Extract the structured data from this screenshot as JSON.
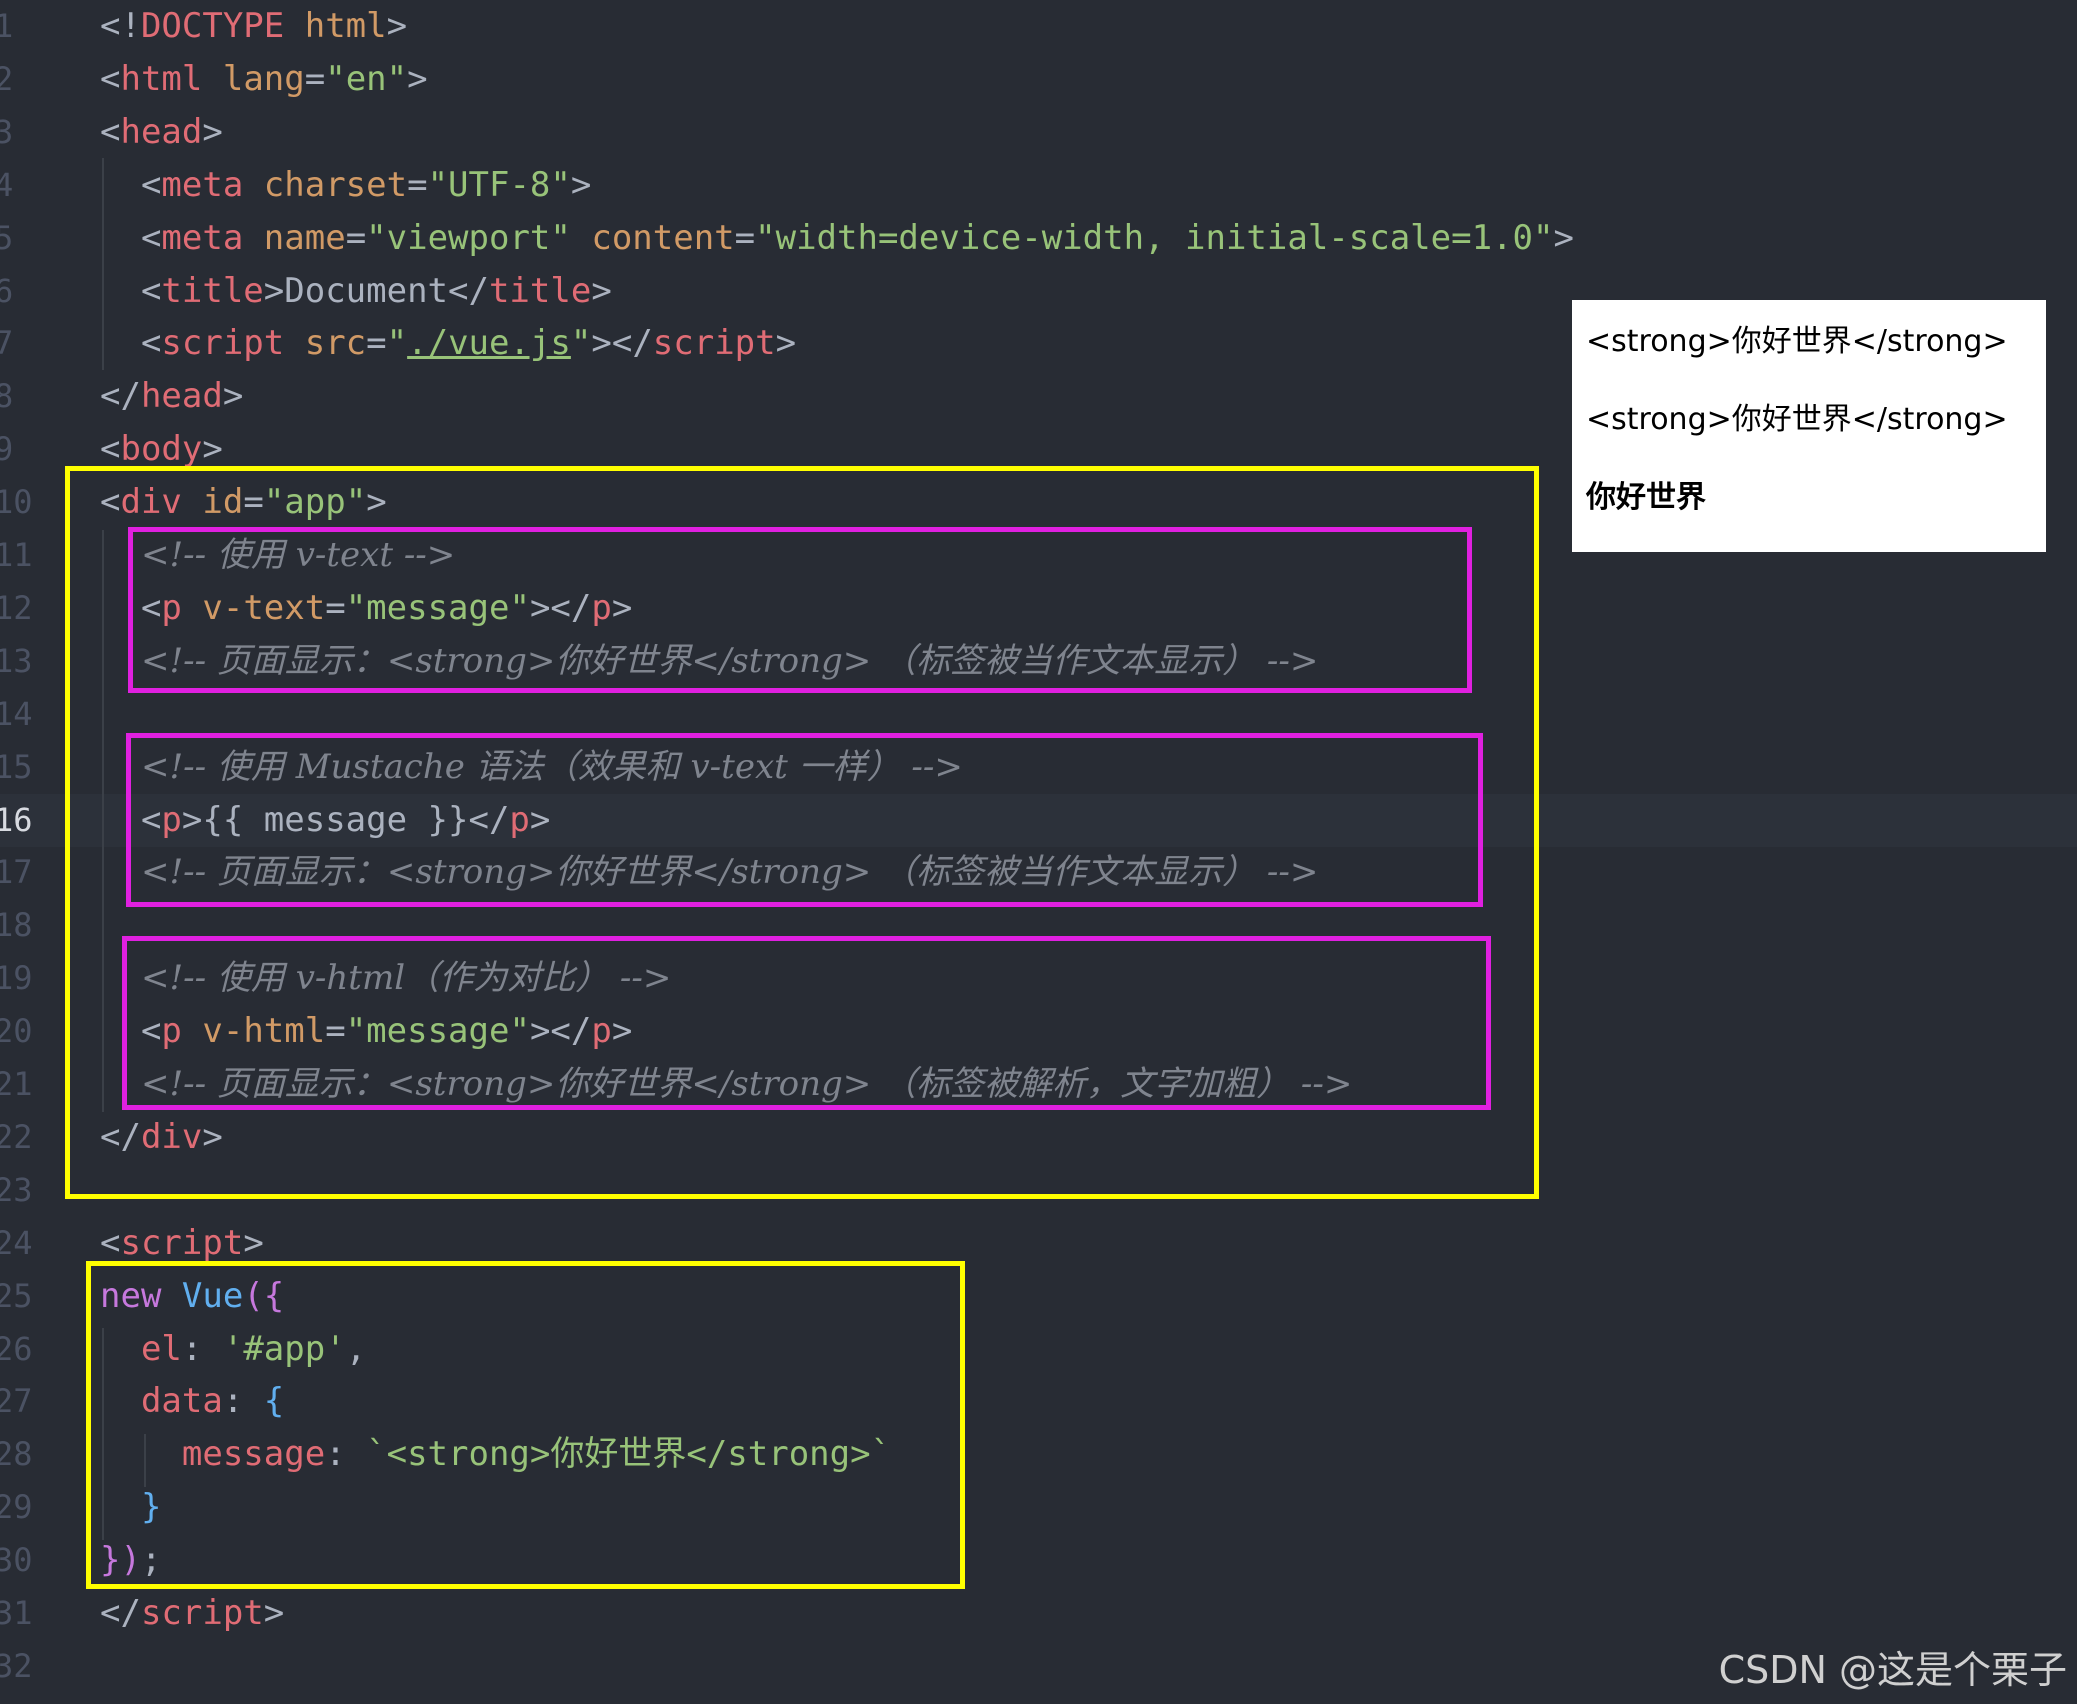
{
  "editor": {
    "current_line": 16,
    "lines": [
      {
        "n": "1",
        "tokens": [
          [
            "punc",
            "<!"
          ],
          [
            "tag",
            "DOCTYPE"
          ],
          [
            "punc",
            " "
          ],
          [
            "attr",
            "html"
          ],
          [
            "punc",
            ">"
          ]
        ]
      },
      {
        "n": "2",
        "tokens": [
          [
            "punc",
            "<"
          ],
          [
            "tag",
            "html"
          ],
          [
            "punc",
            " "
          ],
          [
            "attr",
            "lang"
          ],
          [
            "punc",
            "="
          ],
          [
            "str",
            "\"en\""
          ],
          [
            "punc",
            ">"
          ]
        ]
      },
      {
        "n": "3",
        "tokens": [
          [
            "punc",
            "<"
          ],
          [
            "tag",
            "head"
          ],
          [
            "punc",
            ">"
          ]
        ]
      },
      {
        "n": "4",
        "tokens": [
          [
            "punc",
            "  <"
          ],
          [
            "tag",
            "meta"
          ],
          [
            "punc",
            " "
          ],
          [
            "attr",
            "charset"
          ],
          [
            "punc",
            "="
          ],
          [
            "str",
            "\"UTF-8\""
          ],
          [
            "punc",
            ">"
          ]
        ]
      },
      {
        "n": "5",
        "tokens": [
          [
            "punc",
            "  <"
          ],
          [
            "tag",
            "meta"
          ],
          [
            "punc",
            " "
          ],
          [
            "attr",
            "name"
          ],
          [
            "punc",
            "="
          ],
          [
            "str",
            "\"viewport\""
          ],
          [
            "punc",
            " "
          ],
          [
            "attr",
            "content"
          ],
          [
            "punc",
            "="
          ],
          [
            "str",
            "\"width=device-width, initial-scale=1.0\""
          ],
          [
            "punc",
            ">"
          ]
        ]
      },
      {
        "n": "6",
        "tokens": [
          [
            "punc",
            "  <"
          ],
          [
            "tag",
            "title"
          ],
          [
            "punc",
            ">Document</"
          ],
          [
            "tag",
            "title"
          ],
          [
            "punc",
            ">"
          ]
        ]
      },
      {
        "n": "7",
        "tokens": [
          [
            "punc",
            "  <"
          ],
          [
            "tag",
            "script"
          ],
          [
            "punc",
            " "
          ],
          [
            "attr",
            "src"
          ],
          [
            "punc",
            "="
          ],
          [
            "str",
            "\""
          ],
          [
            "link",
            "./vue.js"
          ],
          [
            "str",
            "\""
          ],
          [
            "punc",
            "></"
          ],
          [
            "tag",
            "script"
          ],
          [
            "punc",
            ">"
          ]
        ]
      },
      {
        "n": "8",
        "tokens": [
          [
            "punc",
            "</"
          ],
          [
            "tag",
            "head"
          ],
          [
            "punc",
            ">"
          ]
        ]
      },
      {
        "n": "9",
        "tokens": [
          [
            "punc",
            "<"
          ],
          [
            "tag",
            "body"
          ],
          [
            "punc",
            ">"
          ]
        ]
      },
      {
        "n": "10",
        "tokens": [
          [
            "punc",
            "<"
          ],
          [
            "tag",
            "div"
          ],
          [
            "punc",
            " "
          ],
          [
            "attr",
            "id"
          ],
          [
            "punc",
            "="
          ],
          [
            "str",
            "\"app\""
          ],
          [
            "punc",
            ">"
          ]
        ]
      },
      {
        "n": "11",
        "tokens": [
          [
            "punc",
            "  "
          ],
          [
            "cm",
            "<!-- 使用 v-text -->"
          ]
        ]
      },
      {
        "n": "12",
        "tokens": [
          [
            "punc",
            "  <"
          ],
          [
            "tag",
            "p"
          ],
          [
            "punc",
            " "
          ],
          [
            "attr",
            "v-text"
          ],
          [
            "punc",
            "="
          ],
          [
            "str",
            "\"message\""
          ],
          [
            "punc",
            "></"
          ],
          [
            "tag",
            "p"
          ],
          [
            "punc",
            ">"
          ]
        ]
      },
      {
        "n": "13",
        "tokens": [
          [
            "punc",
            "  "
          ],
          [
            "cm",
            "<!-- 页面显示：<strong>你好世界</strong> （标签被当作文本显示） -->"
          ]
        ]
      },
      {
        "n": "14",
        "tokens": []
      },
      {
        "n": "15",
        "tokens": [
          [
            "punc",
            "  "
          ],
          [
            "cm",
            "<!-- 使用 Mustache 语法（效果和 v-text 一样） -->"
          ]
        ]
      },
      {
        "n": "16",
        "tokens": [
          [
            "punc",
            "  <"
          ],
          [
            "tag",
            "p"
          ],
          [
            "punc",
            ">{{ message }}</"
          ],
          [
            "tag",
            "p"
          ],
          [
            "punc",
            ">"
          ]
        ]
      },
      {
        "n": "17",
        "tokens": [
          [
            "punc",
            "  "
          ],
          [
            "cm",
            "<!-- 页面显示：<strong>你好世界</strong> （标签被当作文本显示） -->"
          ]
        ]
      },
      {
        "n": "18",
        "tokens": []
      },
      {
        "n": "19",
        "tokens": [
          [
            "punc",
            "  "
          ],
          [
            "cm",
            "<!-- 使用 v-html（作为对比） -->"
          ]
        ]
      },
      {
        "n": "20",
        "tokens": [
          [
            "punc",
            "  <"
          ],
          [
            "tag",
            "p"
          ],
          [
            "punc",
            " "
          ],
          [
            "attr",
            "v-html"
          ],
          [
            "punc",
            "="
          ],
          [
            "str",
            "\"message\""
          ],
          [
            "punc",
            "></"
          ],
          [
            "tag",
            "p"
          ],
          [
            "punc",
            ">"
          ]
        ]
      },
      {
        "n": "21",
        "tokens": [
          [
            "punc",
            "  "
          ],
          [
            "cm",
            "<!-- 页面显示：<strong>你好世界</strong> （标签被解析，文字加粗） -->"
          ]
        ]
      },
      {
        "n": "22",
        "tokens": [
          [
            "punc",
            "</"
          ],
          [
            "tag",
            "div"
          ],
          [
            "punc",
            ">"
          ]
        ]
      },
      {
        "n": "23",
        "tokens": []
      },
      {
        "n": "24",
        "tokens": [
          [
            "punc",
            "<"
          ],
          [
            "tag",
            "script"
          ],
          [
            "punc",
            ">"
          ]
        ]
      },
      {
        "n": "25",
        "tokens": [
          [
            "kw",
            "new"
          ],
          [
            "punc",
            " "
          ],
          [
            "fn",
            "Vue"
          ],
          [
            "kw",
            "({"
          ]
        ]
      },
      {
        "n": "26",
        "tokens": [
          [
            "punc",
            "  "
          ],
          [
            "tag",
            "el"
          ],
          [
            "punc",
            ": "
          ],
          [
            "str",
            "'#app'"
          ],
          [
            "punc",
            ","
          ]
        ]
      },
      {
        "n": "27",
        "tokens": [
          [
            "punc",
            "  "
          ],
          [
            "tag",
            "data"
          ],
          [
            "punc",
            ": "
          ],
          [
            "fn",
            "{"
          ]
        ]
      },
      {
        "n": "28",
        "tokens": [
          [
            "punc",
            "    "
          ],
          [
            "tag",
            "message"
          ],
          [
            "punc",
            ": "
          ],
          [
            "str",
            "`<strong>你好世界</strong>`"
          ]
        ]
      },
      {
        "n": "29",
        "tokens": [
          [
            "punc",
            "  "
          ],
          [
            "fn",
            "}"
          ]
        ]
      },
      {
        "n": "30",
        "tokens": [
          [
            "kw",
            "})"
          ],
          [
            "punc",
            ";"
          ]
        ]
      },
      {
        "n": "31",
        "tokens": [
          [
            "punc",
            "</"
          ],
          [
            "tag",
            "script"
          ],
          [
            "punc",
            ">"
          ]
        ]
      },
      {
        "n": "32",
        "tokens": []
      }
    ]
  },
  "preview": {
    "line1": "<strong>你好世界</strong>",
    "line2": "<strong>你好世界</strong>",
    "line3": "你好世界"
  },
  "watermark": "CSDN @这是个栗子",
  "colors": {
    "background": "#282c34",
    "highlight_yellow": "#ffff00",
    "highlight_magenta": "#e020e0"
  }
}
